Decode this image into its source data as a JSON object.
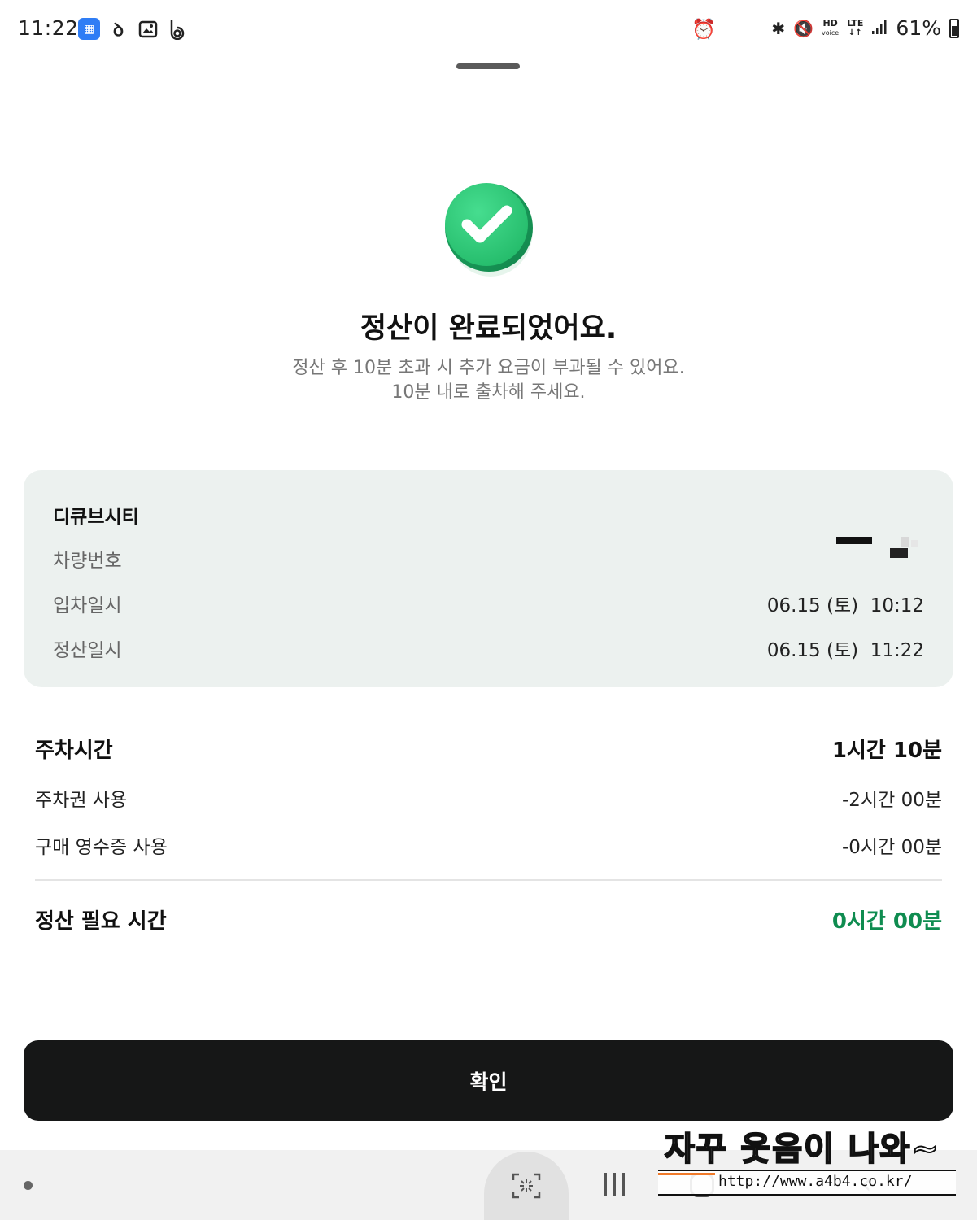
{
  "status_bar": {
    "time": "11:22",
    "left_icons": [
      "news-app-icon",
      "notification-dot-icon",
      "gallery-icon",
      "b-app-icon"
    ],
    "alarm_icon": "alarm-icon",
    "right_icons": [
      "bluetooth-icon",
      "mute-icon",
      "hd-voice-icon",
      "lte-icon",
      "signal-icon"
    ],
    "hd_label_top": "HD",
    "hd_label_bottom": "voice",
    "lte_label": "LTE",
    "battery_percent": "61%",
    "battery_level": 0.61
  },
  "result": {
    "title": "정산이 완료되었어요.",
    "subtitle_line1": "정산 후 10분 초과 시 추가 요금이 부과될 수 있어요.",
    "subtitle_line2": "10분 내로 출차해 주세요.",
    "success_icon": "check-circle-icon",
    "success_color": "#2ecf7a"
  },
  "info_card": {
    "place_name": "디큐브시티",
    "rows": [
      {
        "label": "차량번호",
        "value": ""
      },
      {
        "label": "입차일시",
        "value": "06.15 (토)  10:12"
      },
      {
        "label": "정산일시",
        "value": "06.15 (토)  11:22"
      }
    ]
  },
  "summary": {
    "parking_time_label": "주차시간",
    "parking_time_value": "1시간 10분",
    "ticket_label": "주차권 사용",
    "ticket_value": "-2시간 00분",
    "receipt_label": "구매 영수증 사용",
    "receipt_value": "-0시간 00분",
    "required_label": "정산 필요 시간",
    "required_value": "0시간 00분",
    "accent_color": "#0f8c50"
  },
  "confirm_button": {
    "label": "확인"
  },
  "nav_bar": {
    "icons": [
      "nav-dot-icon",
      "screen-capture-icon",
      "recents-icon",
      "home-icon",
      "back-icon"
    ]
  },
  "watermark": {
    "text": "자꾸 웃음이 나와~",
    "url": "http://www.a4b4.co.kr/"
  }
}
